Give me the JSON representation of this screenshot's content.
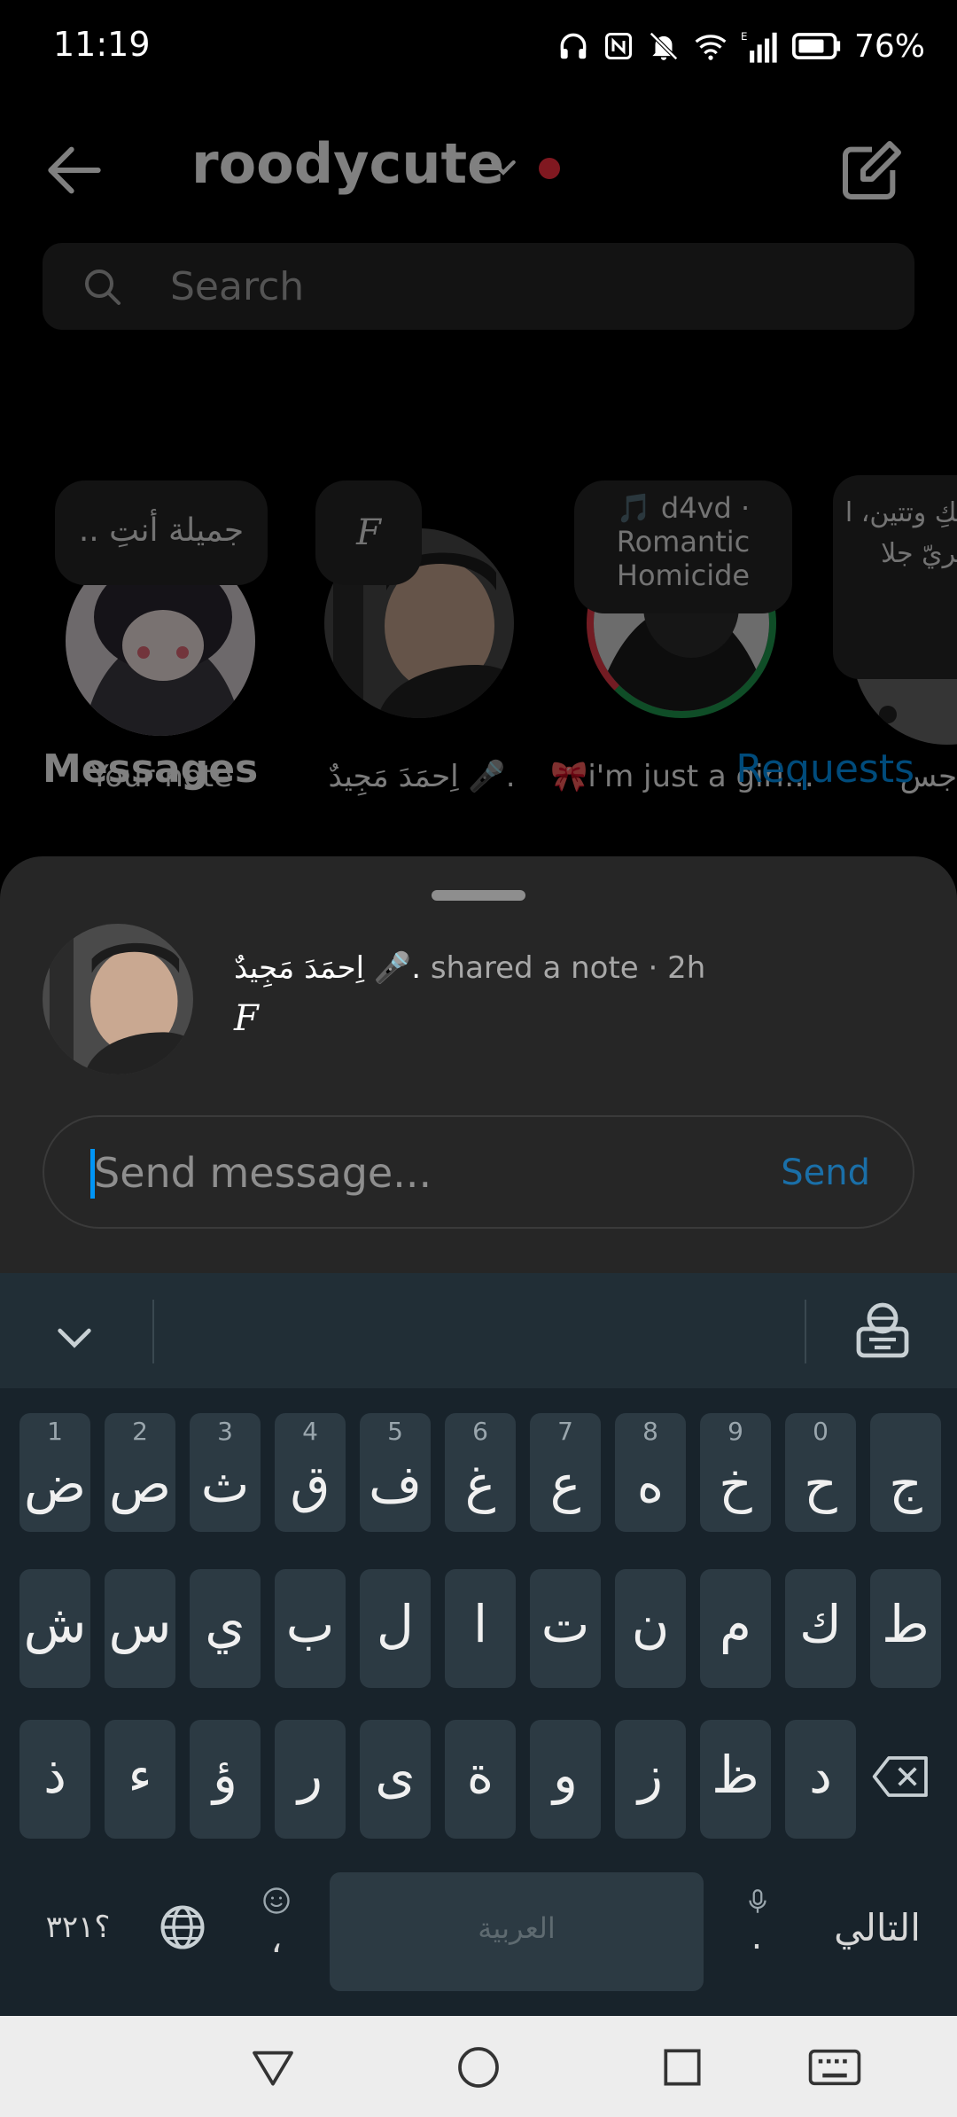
{
  "status": {
    "time": "11:19",
    "battery": "76%",
    "icons": [
      "headphones-icon",
      "nfc-icon",
      "bell-off-icon",
      "wifi-icon",
      "signal-icon",
      "battery-icon"
    ]
  },
  "header": {
    "username": "roodycute",
    "back_icon": "arrow-left-icon",
    "compose_icon": "compose-icon"
  },
  "search": {
    "placeholder": "Search"
  },
  "notes": [
    {
      "label": "Your note",
      "bubble": "جميلة أنتِ ..",
      "avatar": "anime-avatar"
    },
    {
      "label": "اِحمَدَ مَجِيدٌ 🎤.",
      "bubble": "F",
      "avatar": "profile-photo"
    },
    {
      "label": "🎀i'm just a girl…",
      "bubble_music": "🎵 d4vd ·",
      "bubble_song": "Romantic Homicide",
      "avatar": "profile-photo"
    },
    {
      "label": "جس",
      "bubble": "بعينيكِ وتتين، ا جوهريّ جلا",
      "avatar": "profile-photo"
    }
  ],
  "section": {
    "messages": "Messages",
    "requests": "Requests"
  },
  "sheet": {
    "name": "اِحمَدَ مَجِيدٌ 🎤.",
    "action": "shared a note",
    "time": "· 2h",
    "note": "F",
    "input_placeholder": "Send message...",
    "send": "Send"
  },
  "keyboard": {
    "row1": [
      {
        "c": "ض",
        "n": "1"
      },
      {
        "c": "ص",
        "n": "2"
      },
      {
        "c": "ث",
        "n": "3"
      },
      {
        "c": "ق",
        "n": "4"
      },
      {
        "c": "ف",
        "n": "5"
      },
      {
        "c": "غ",
        "n": "6"
      },
      {
        "c": "ع",
        "n": "7"
      },
      {
        "c": "ه",
        "n": "8"
      },
      {
        "c": "خ",
        "n": "9"
      },
      {
        "c": "ح",
        "n": "0"
      },
      {
        "c": "ج",
        "n": ""
      }
    ],
    "row2": [
      "ش",
      "س",
      "ي",
      "ب",
      "ل",
      "ا",
      "ت",
      "ن",
      "م",
      "ك",
      "ط"
    ],
    "row3": [
      "ذ",
      "ء",
      "ؤ",
      "ر",
      "ى",
      "ة",
      "و",
      "ز",
      "ظ",
      "د"
    ],
    "symbols": "؟٣٢١",
    "comma": "،",
    "space_label": "العربية",
    "period": ".",
    "next": "التالي"
  },
  "colors": {
    "accent": "#0095f6",
    "notification_dot": "#ff3040",
    "keyboard_bg": "#18232b"
  }
}
